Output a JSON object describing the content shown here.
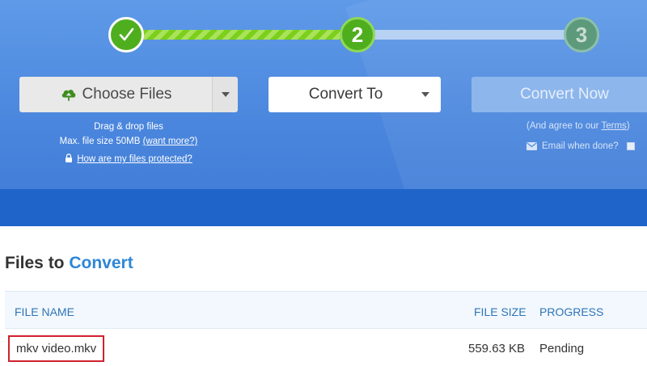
{
  "steps": [
    {
      "number": "1",
      "state": "done"
    },
    {
      "number": "2",
      "state": "current"
    },
    {
      "number": "3",
      "state": "upcoming"
    }
  ],
  "upload": {
    "choose_label": "Choose Files",
    "drag_text": "Drag & drop files",
    "max_size_text": "Max. file size 50MB",
    "want_more_link": "(want more?)",
    "protected_link": "How are my files protected?"
  },
  "convert_to": {
    "label": "Convert To"
  },
  "convert_now": {
    "label": "Convert Now",
    "agree_prefix": "(And agree to our ",
    "terms_link": "Terms",
    "agree_suffix": ")",
    "email_label": "Email when done?"
  },
  "files": {
    "title_prefix": "Files to",
    "title_accent": "Convert",
    "columns": {
      "name": "FILE NAME",
      "size": "FILE SIZE",
      "progress": "PROGRESS"
    },
    "rows": [
      {
        "name": "mkv video.mkv",
        "size": "559.63 KB",
        "progress": "Pending"
      }
    ]
  },
  "colors": {
    "hero_blue": "#4a86dd",
    "hero_band": "#1f64c8",
    "step_done": "#4fae1e",
    "accent_text": "#2f86d6",
    "highlight_border": "#d0212f"
  }
}
